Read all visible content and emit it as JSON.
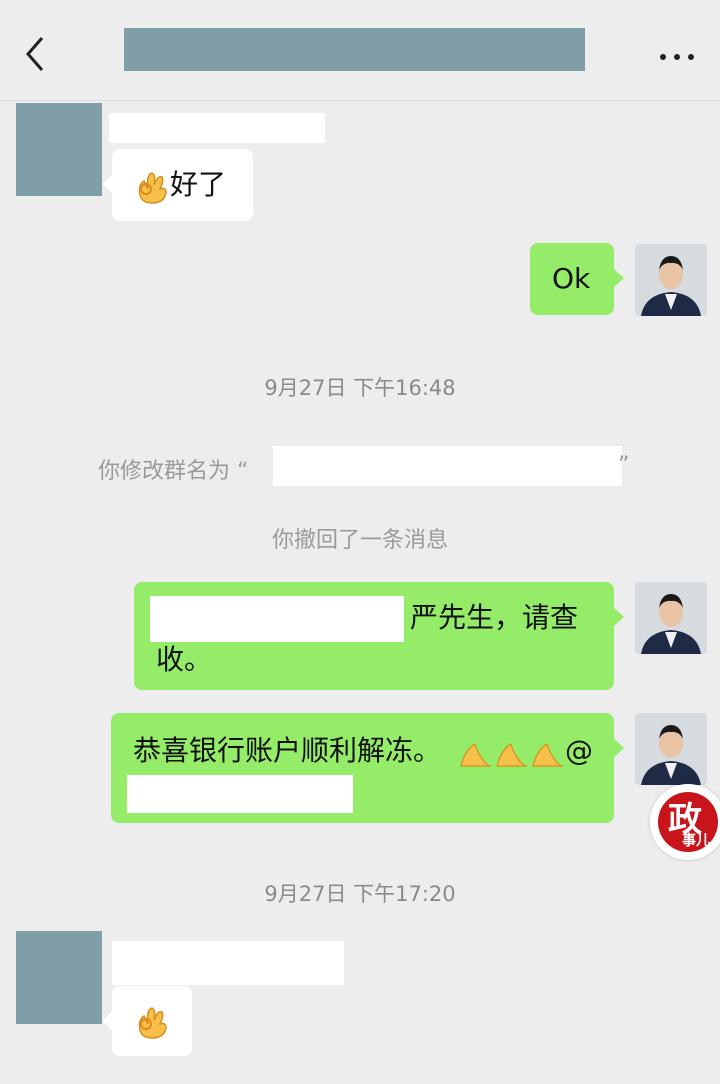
{
  "header": {
    "back_icon": "chevron-left-icon",
    "title": "",
    "more_icon": "ellipsis-icon"
  },
  "messages": [
    {
      "side": "left",
      "sender_name": "",
      "emoji": "ok-hand-icon",
      "text": "好了"
    },
    {
      "side": "right",
      "text": "Ok"
    },
    {
      "type": "timestamp",
      "text": "9月27日 下午16:48"
    },
    {
      "type": "system",
      "prefix": "你修改群名为 “",
      "suffix": "”"
    },
    {
      "type": "system",
      "text": "你撤回了一条消息"
    },
    {
      "side": "right",
      "line1": "严先生，请查",
      "line2": "收。"
    },
    {
      "side": "right",
      "text": "恭喜银行账户顺利解冻。",
      "emoji": "pray-hands-icon",
      "mention": "@"
    },
    {
      "type": "timestamp",
      "text": "9月27日 下午17:20"
    },
    {
      "side": "left",
      "sender_name": "",
      "emoji": "ok-hand-icon",
      "text": ""
    }
  ],
  "colors": {
    "background": "#ededed",
    "self_bubble": "#95ec69",
    "other_bubble": "#ffffff",
    "redaction": "#7f9ea8"
  },
  "watermark": {
    "big": "政",
    "small": "事儿"
  }
}
